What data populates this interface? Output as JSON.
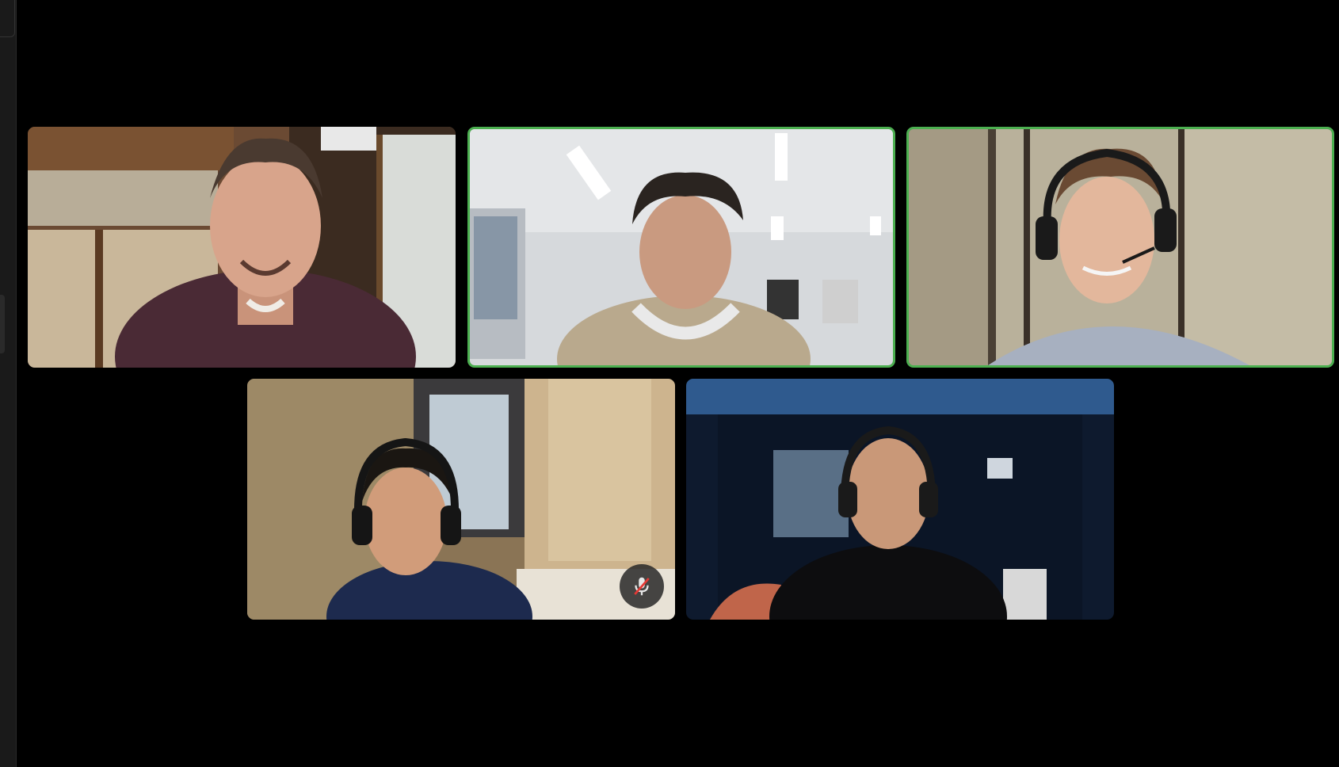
{
  "meeting": {
    "layout": "gallery",
    "participant_count": 5,
    "accent_colors": {
      "active_speaker_border": "#4caf50",
      "background": "#000000"
    }
  },
  "participants": [
    {
      "id": 1,
      "active_speaker": false,
      "muted": false
    },
    {
      "id": 2,
      "active_speaker": true,
      "muted": false
    },
    {
      "id": 3,
      "active_speaker": true,
      "muted": false
    },
    {
      "id": 4,
      "active_speaker": false,
      "muted": true,
      "mute_icon": "microphone-off-icon"
    },
    {
      "id": 5,
      "active_speaker": false,
      "muted": false
    }
  ]
}
